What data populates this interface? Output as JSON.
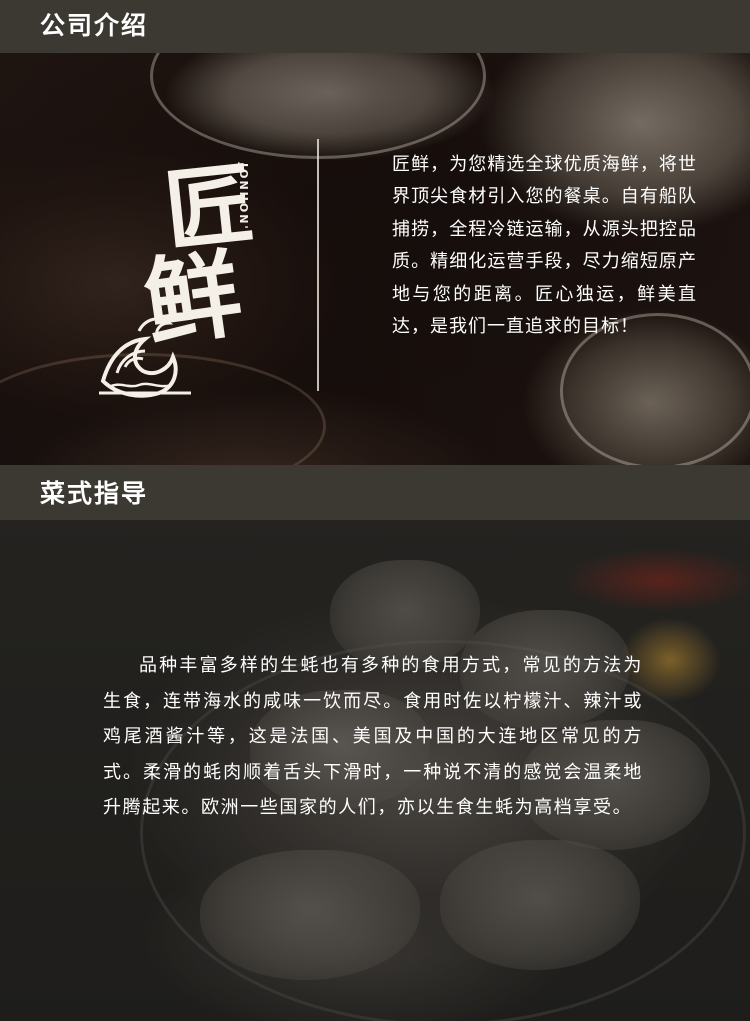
{
  "sections": {
    "company": {
      "title": "公司介绍",
      "logo": {
        "char_1": "匠",
        "char_2": "鲜",
        "latin": "JONHON'S"
      },
      "description": "匠鲜，为您精选全球优质海鲜，将世界顶尖食材引入您的餐桌。自有船队捕捞，全程冷链运输，从源头把控品质。精细化运营手段，尽力缩短原产地与您的距离。匠心独运，鲜美直达，是我们一直追求的目标！"
    },
    "dishes": {
      "title": "菜式指导",
      "description": "品种丰富多样的生蚝也有多种的食用方式，常见的方法为生食，连带海水的咸味一饮而尽。食用时佐以柠檬汁、辣汁或鸡尾酒酱汁等，这是法国、美国及中国的大连地区常见的方式。柔滑的蚝肉顺着舌头下滑时，一种说不清的感觉会温柔地升腾起来。欧洲一些国家的人们，亦以生食生蚝为高档享受。"
    }
  },
  "icons": {
    "logo_wave": "wave-icon"
  },
  "colors": {
    "header_bg": "#3b3931",
    "text": "#ffffff"
  }
}
